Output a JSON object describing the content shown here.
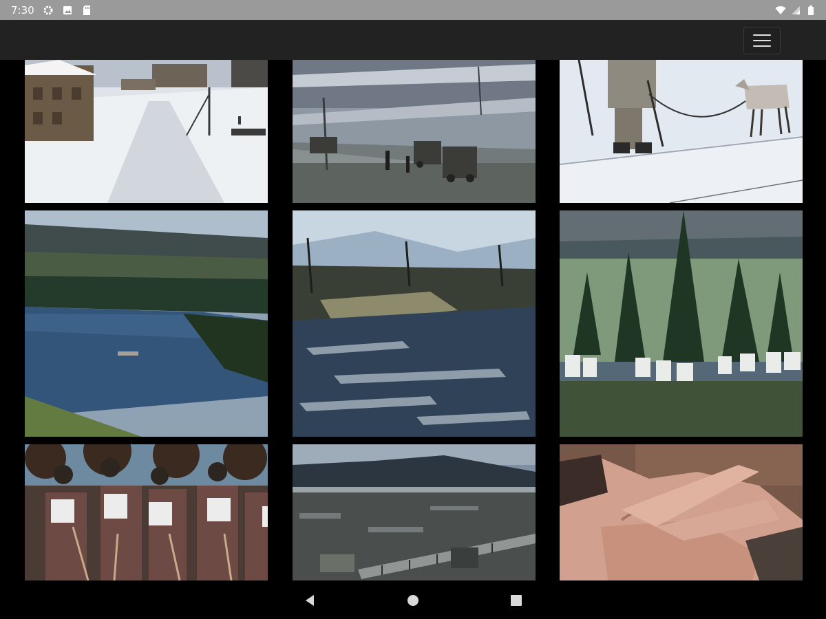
{
  "status_bar": {
    "time": "7:30",
    "left_icons": [
      "gear-icon",
      "image-icon",
      "sd-card-icon"
    ],
    "right_icons": [
      "wifi-icon",
      "signal-icon",
      "battery-icon"
    ]
  },
  "toolbar": {
    "menu_icon": "hamburger-menu-icon"
  },
  "gallery": {
    "tiles": [
      {
        "name": "photo-snowy-village-road"
      },
      {
        "name": "photo-trucks-on-snowy-road"
      },
      {
        "name": "photo-soldier-with-reindeer"
      },
      {
        "name": "photo-river-landscape"
      },
      {
        "name": "photo-river-rapids"
      },
      {
        "name": "photo-forest-laundry"
      },
      {
        "name": "photo-ski-troops"
      },
      {
        "name": "photo-bridge-valley"
      },
      {
        "name": "photo-resting-man"
      }
    ]
  },
  "nav_bar": {
    "icons": [
      "back-icon",
      "home-icon",
      "recents-icon"
    ]
  },
  "colors": {
    "status_bar_bg": "#9a9a9a",
    "toolbar_bg": "#222222",
    "background": "#000000"
  }
}
